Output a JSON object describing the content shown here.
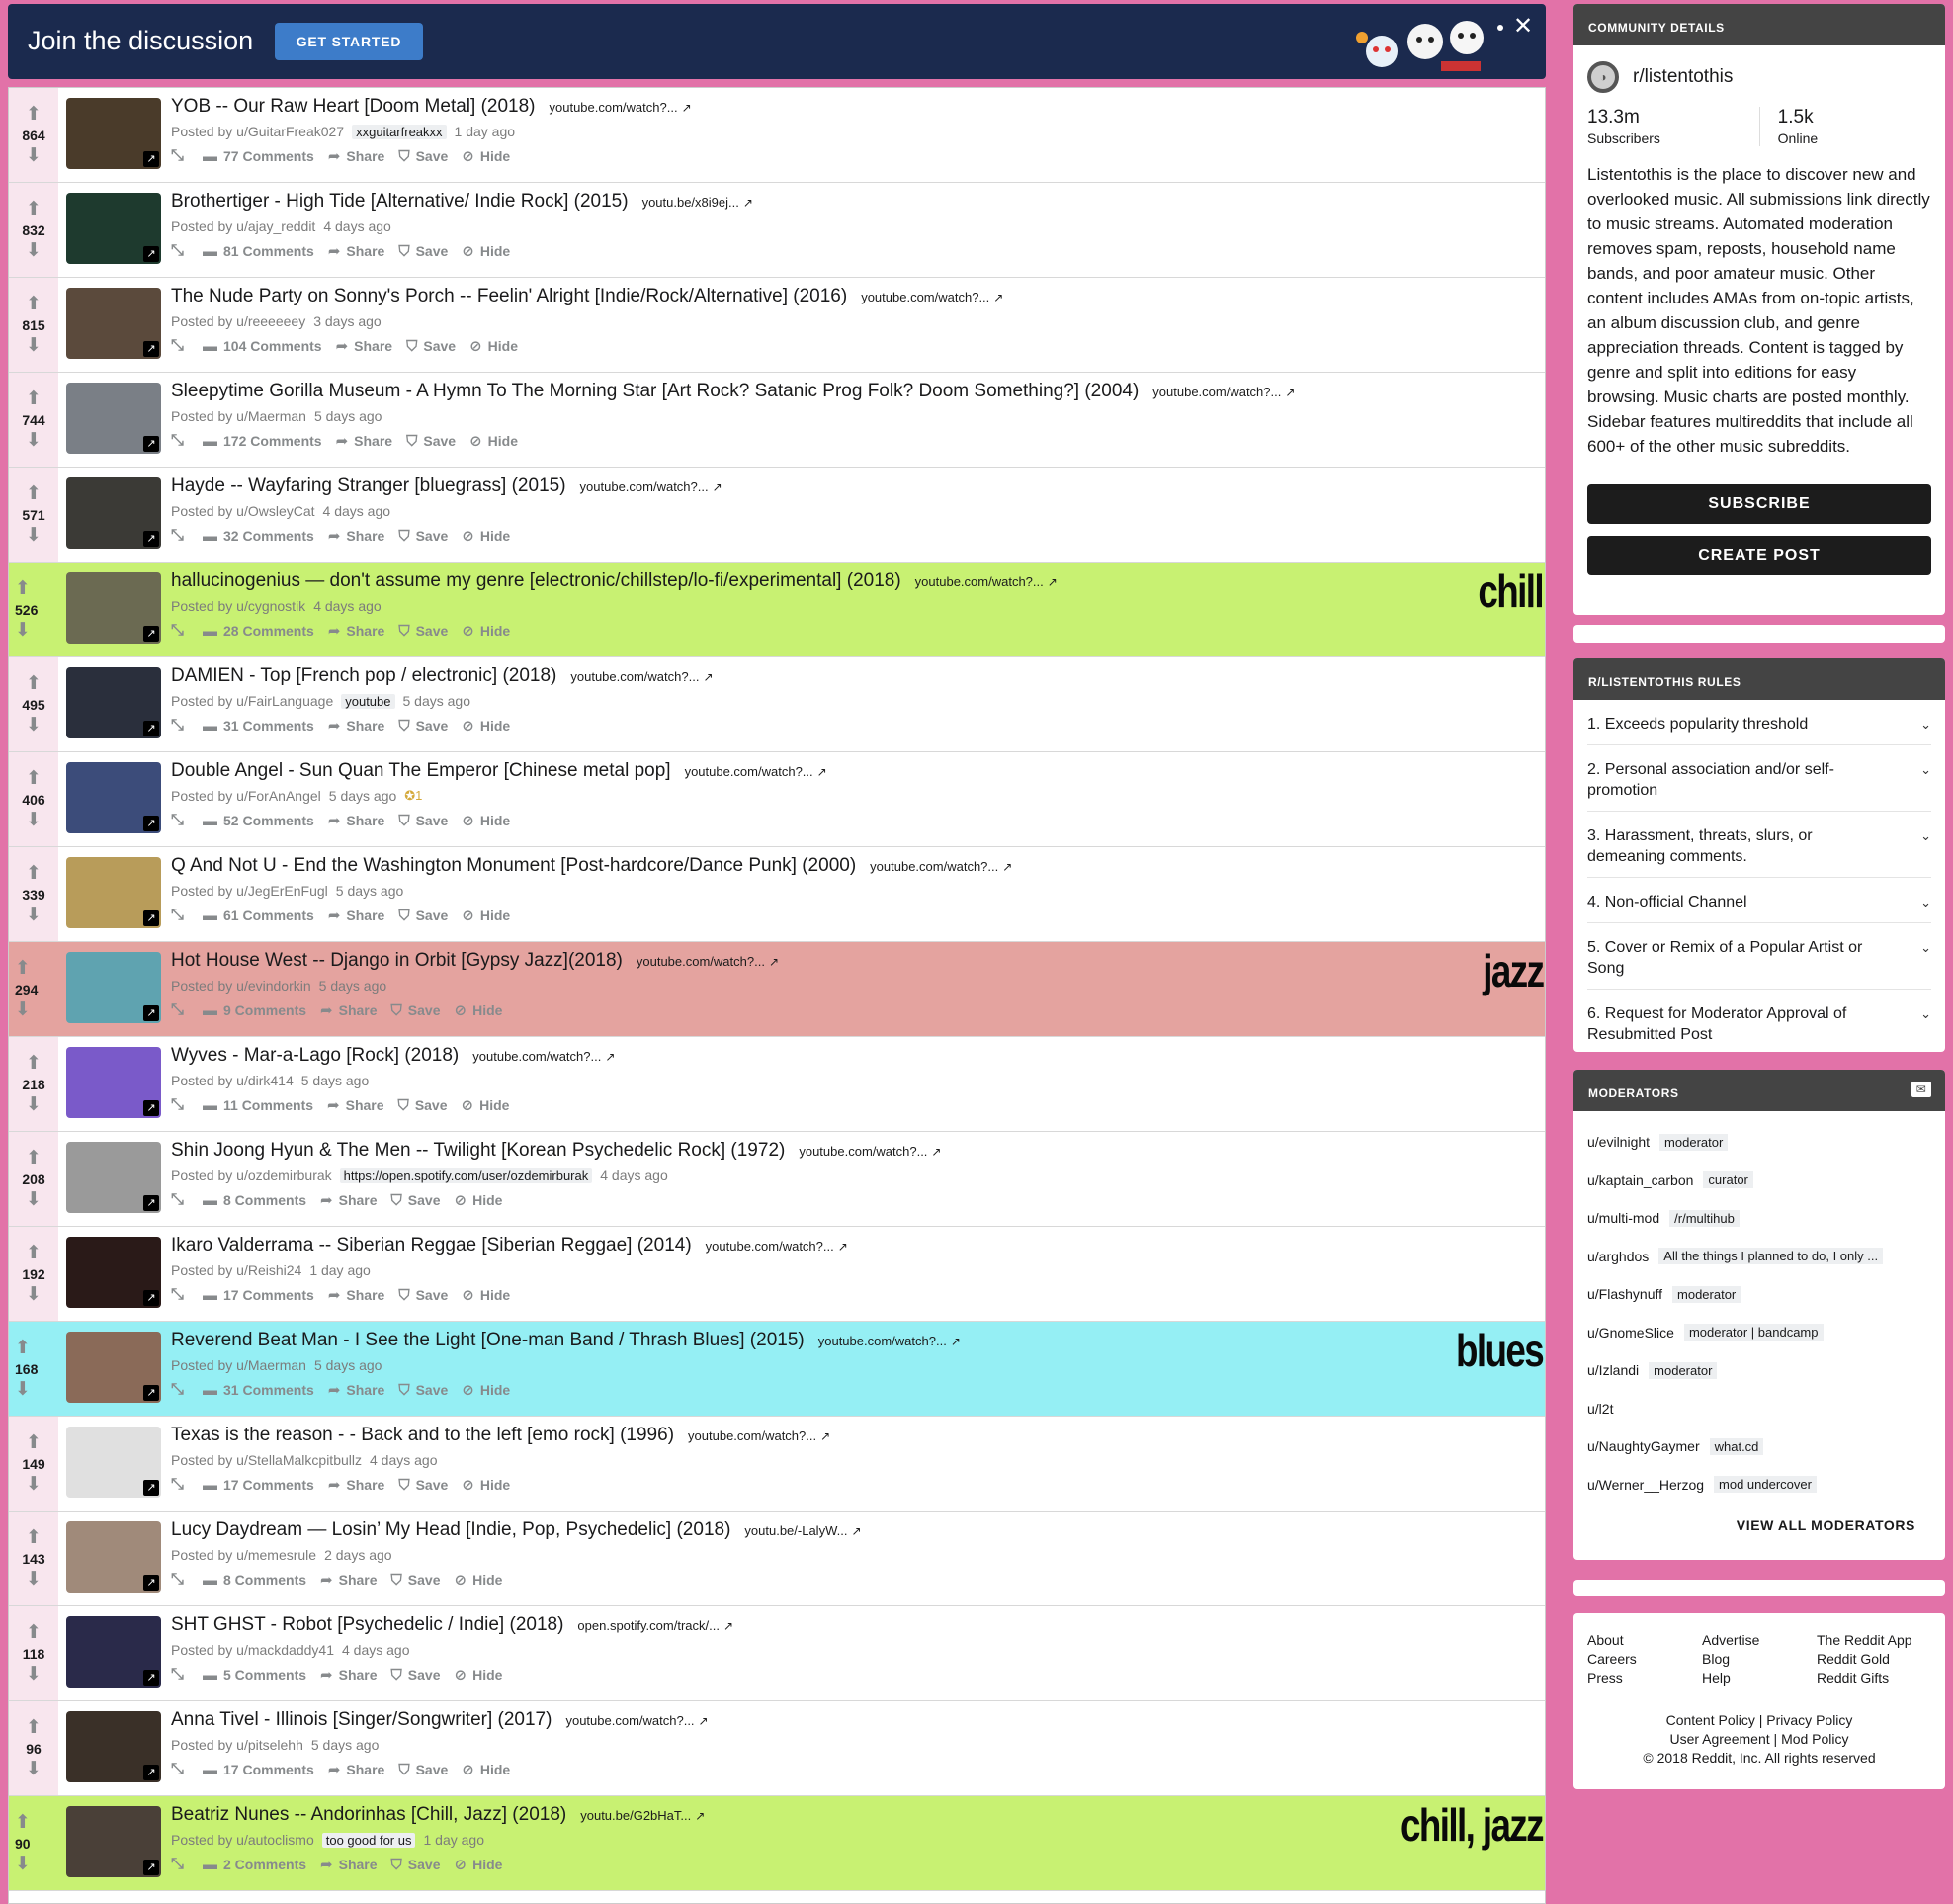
{
  "banner": {
    "title": "Join the discussion",
    "button": "GET STARTED",
    "close": "✕"
  },
  "icons": {
    "upvote": "arrow-up",
    "downvote": "arrow-down",
    "comments": "speech-bubble",
    "share": "share-arrow",
    "save": "bookmark",
    "hide": "ban-circle",
    "expand": "expand-arrows",
    "external": "external-link"
  },
  "colors": {
    "green": "#c8f172",
    "pink": "#e4a39f",
    "cyan": "#95eff4",
    "page_bg": "#e272a8",
    "banner_bg": "#1b2a4e",
    "accent_button": "#3d7cc9"
  },
  "posts": [
    {
      "score": "864",
      "title": "YOB -- Our Raw Heart [Doom Metal] (2018)",
      "domain": "youtube.com/watch?...",
      "author": "Posted by u/GuitarFreak027",
      "flair": "xxguitarfreakxx",
      "time": "1 day ago",
      "comments": "77 Comments",
      "hl": "",
      "tag": ""
    },
    {
      "score": "832",
      "title": "Brothertiger - High Tide [Alternative/ Indie Rock] (2015)",
      "domain": "youtu.be/x8i9ej...",
      "author": "Posted by u/ajay_reddit",
      "flair": "",
      "time": "4 days ago",
      "comments": "81 Comments",
      "hl": "",
      "tag": ""
    },
    {
      "score": "815",
      "title": "The Nude Party on Sonny's Porch -- Feelin' Alright [Indie/Rock/Alternative] (2016)",
      "domain": "youtube.com/watch?...",
      "author": "Posted by u/reeeeeey",
      "flair": "",
      "time": "3 days ago",
      "comments": "104 Comments",
      "hl": "",
      "tag": ""
    },
    {
      "score": "744",
      "title": "Sleepytime Gorilla Museum - A Hymn To The Morning Star [Art Rock? Satanic Prog Folk? Doom Something?] (2004)",
      "domain": "youtube.com/watch?...",
      "author": "Posted by u/Maerman",
      "flair": "",
      "time": "5 days ago",
      "comments": "172 Comments",
      "hl": "",
      "tag": ""
    },
    {
      "score": "571",
      "title": "Hayde -- Wayfaring Stranger [bluegrass] (2015)",
      "domain": "youtube.com/watch?...",
      "author": "Posted by u/OwsleyCat",
      "flair": "",
      "time": "4 days ago",
      "comments": "32 Comments",
      "hl": "",
      "tag": ""
    },
    {
      "score": "526",
      "title": "hallucinogenius — don't assume my genre [electronic/chillstep/lo-fi/experimental] (2018)",
      "domain": "youtube.com/watch?...",
      "author": "Posted by u/cygnostik",
      "flair": "",
      "time": "4 days ago",
      "comments": "28 Comments",
      "hl": "green",
      "tag": "chill"
    },
    {
      "score": "495",
      "title": "DAMIEN - Top [French pop / electronic] (2018)",
      "domain": "youtube.com/watch?...",
      "author": "Posted by u/FairLanguage",
      "flair": "youtube",
      "time": "5 days ago",
      "comments": "31 Comments",
      "hl": "",
      "tag": ""
    },
    {
      "score": "406",
      "title": "Double Angel - Sun Quan The Emperor [Chinese metal pop]",
      "domain": "youtube.com/watch?...",
      "author": "Posted by u/ForAnAngel",
      "flair": "",
      "time": "5 days ago",
      "award": "1",
      "comments": "52 Comments",
      "hl": "",
      "tag": ""
    },
    {
      "score": "339",
      "title": "Q And Not U - End the Washington Monument [Post-hardcore/Dance Punk] (2000)",
      "domain": "youtube.com/watch?...",
      "author": "Posted by u/JegErEnFugl",
      "flair": "",
      "time": "5 days ago",
      "comments": "61 Comments",
      "hl": "",
      "tag": ""
    },
    {
      "score": "294",
      "title": "Hot House West -- Django in Orbit [Gypsy Jazz](2018)",
      "domain": "youtube.com/watch?...",
      "author": "Posted by u/evindorkin",
      "flair": "",
      "time": "5 days ago",
      "comments": "9 Comments",
      "hl": "pink",
      "tag": "jazz"
    },
    {
      "score": "218",
      "title": "Wyves - Mar-a-Lago [Rock] (2018)",
      "domain": "youtube.com/watch?...",
      "author": "Posted by u/dirk414",
      "flair": "",
      "time": "5 days ago",
      "comments": "11 Comments",
      "hl": "",
      "tag": ""
    },
    {
      "score": "208",
      "title": "Shin Joong Hyun & The Men -- Twilight [Korean Psychedelic Rock] (1972)",
      "domain": "youtube.com/watch?...",
      "author": "Posted by u/ozdemirburak",
      "flair": "https://open.spotify.com/user/ozdemirburak",
      "time": "4 days ago",
      "comments": "8 Comments",
      "hl": "",
      "tag": ""
    },
    {
      "score": "192",
      "title": "Ikaro Valderrama -- Siberian Reggae [Siberian Reggae] (2014)",
      "domain": "youtube.com/watch?...",
      "author": "Posted by u/Reishi24",
      "flair": "",
      "time": "1 day ago",
      "comments": "17 Comments",
      "hl": "",
      "tag": ""
    },
    {
      "score": "168",
      "title": "Reverend Beat Man - I See the Light [One-man Band / Thrash Blues] (2015)",
      "domain": "youtube.com/watch?...",
      "author": "Posted by u/Maerman",
      "flair": "",
      "time": "5 days ago",
      "comments": "31 Comments",
      "hl": "cyan",
      "tag": "blues"
    },
    {
      "score": "149",
      "title": "Texas is the reason - - Back and to the left [emo rock] (1996)",
      "domain": "youtube.com/watch?...",
      "author": "Posted by u/StellaMalkcpitbullz",
      "flair": "",
      "time": "4 days ago",
      "comments": "17 Comments",
      "hl": "",
      "tag": ""
    },
    {
      "score": "143",
      "title": "Lucy Daydream — Losin’ My Head [Indie, Pop, Psychedelic] (2018)",
      "domain": "youtu.be/-LalyW...",
      "author": "Posted by u/memesrule",
      "flair": "",
      "time": "2 days ago",
      "comments": "8 Comments",
      "hl": "",
      "tag": ""
    },
    {
      "score": "118",
      "title": "SHT GHST - Robot [Psychedelic / Indie] (2018)",
      "domain": "open.spotify.com/track/...",
      "author": "Posted by u/mackdaddy41",
      "flair": "",
      "time": "4 days ago",
      "comments": "5 Comments",
      "hl": "",
      "tag": ""
    },
    {
      "score": "96",
      "title": "Anna Tivel - Illinois [Singer/Songwriter] (2017)",
      "domain": "youtube.com/watch?...",
      "author": "Posted by u/pitselehh",
      "flair": "",
      "time": "5 days ago",
      "comments": "17 Comments",
      "hl": "",
      "tag": ""
    },
    {
      "score": "90",
      "title": "Beatriz Nunes -- Andorinhas [Chill, Jazz] (2018)",
      "domain": "youtu.be/G2bHaT...",
      "author": "Posted by u/autoclismo",
      "flair": "too good for us",
      "time": "1 day ago",
      "comments": "2 Comments",
      "hl": "green",
      "tag": "chill, jazz"
    }
  ],
  "actions": {
    "share": "Share",
    "save": "Save",
    "hide": "Hide"
  },
  "community": {
    "heading": "COMMUNITY DETAILS",
    "name": "r/listentothis",
    "subscribers_value": "13.3m",
    "subscribers_label": "Subscribers",
    "online_value": "1.5k",
    "online_label": "Online",
    "description": "Listentothis is the place to discover new and overlooked music. All submissions link directly to music streams. Automated moderation removes spam, reposts, household name bands, and poor amateur music. Other content includes AMAs from on-topic artists, an album discussion club, and genre appreciation threads. Content is tagged by genre and split into editions for easy browsing. Music charts are posted monthly. Sidebar features multireddits that include all 600+ of the other music subreddits.",
    "subscribe": "SUBSCRIBE",
    "create_post": "CREATE POST"
  },
  "rules": {
    "heading": "R/LISTENTOTHIS RULES",
    "items": [
      "1. Exceeds popularity threshold",
      "2. Personal association and/or self-promotion",
      "3. Harassment, threats, slurs, or demeaning comments.",
      "4. Non-official Channel",
      "5. Cover or Remix of a Popular Artist or Song",
      "6. Request for Moderator Approval of Resubmitted Post"
    ]
  },
  "moderators": {
    "heading": "MODERATORS",
    "items": [
      {
        "name": "u/evilnight",
        "flair": "moderator"
      },
      {
        "name": "u/kaptain_carbon",
        "flair": "curator"
      },
      {
        "name": "u/multi-mod",
        "flair": "/r/multihub"
      },
      {
        "name": "u/arghdos",
        "flair": "All the things I planned to do, I only ..."
      },
      {
        "name": "u/Flashynuff",
        "flair": "moderator"
      },
      {
        "name": "u/GnomeSlice",
        "flair": "moderator | bandcamp"
      },
      {
        "name": "u/Izlandi",
        "flair": "moderator"
      },
      {
        "name": "u/l2t",
        "flair": ""
      },
      {
        "name": "u/NaughtyGaymer",
        "flair": "what.cd"
      },
      {
        "name": "u/Werner__Herzog",
        "flair": "mod undercover"
      }
    ],
    "view_all": "VIEW ALL MODERATORS"
  },
  "footer": {
    "col1": [
      "About",
      "Careers",
      "Press"
    ],
    "col2": [
      "Advertise",
      "Blog",
      "Help"
    ],
    "col3": [
      "The Reddit App",
      "Reddit Gold",
      "Reddit Gifts"
    ],
    "legal1a": "Content Policy",
    "legal1b": "Privacy Policy",
    "legal2a": "User Agreement",
    "legal2b": "Mod Policy",
    "sep": " | ",
    "copyright": "© 2018 Reddit, Inc. All rights reserved"
  }
}
